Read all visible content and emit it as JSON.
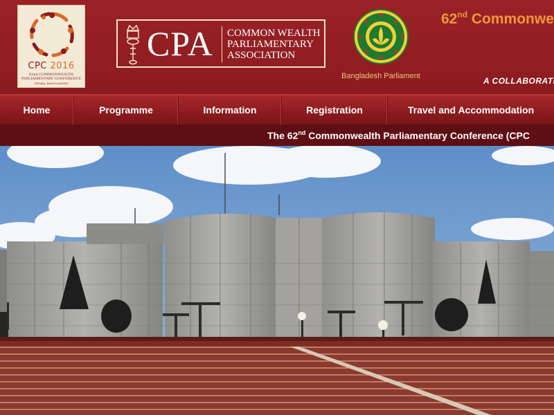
{
  "header": {
    "cpc_logo": {
      "year_prefix": "CPC",
      "year": "2016",
      "subtitle": "62nd COMMONWEALTH PARLIAMENTARY CONFERENCE",
      "location": "DHAKA, BANGLADESH"
    },
    "cpa_logo": {
      "acronym": "CPA",
      "line1": "COMMON WEALTH",
      "line2": "PARLIAMENTARY",
      "line3": "ASSOCIATION"
    },
    "bd_emblem": {
      "caption": "Bangladesh Parliament"
    },
    "title_number": "62",
    "title_suffix": "nd",
    "title_text": " Commonwealth",
    "tagline": "A COLLABORATIVE"
  },
  "nav": {
    "items": [
      "Home",
      "Programme",
      "Information",
      "Registration",
      "Travel and Accommodation"
    ]
  },
  "ticker": {
    "prefix": "The 62",
    "suffix": "nd",
    "text": " Commonwealth Parliamentary Conference (CPC"
  },
  "colors": {
    "brand_red": "#8e1b1f",
    "nav_red": "#a7282b",
    "ticker_bg": "#5e0f13",
    "accent_orange": "#f0973c",
    "emblem_green": "#1f7a30"
  }
}
